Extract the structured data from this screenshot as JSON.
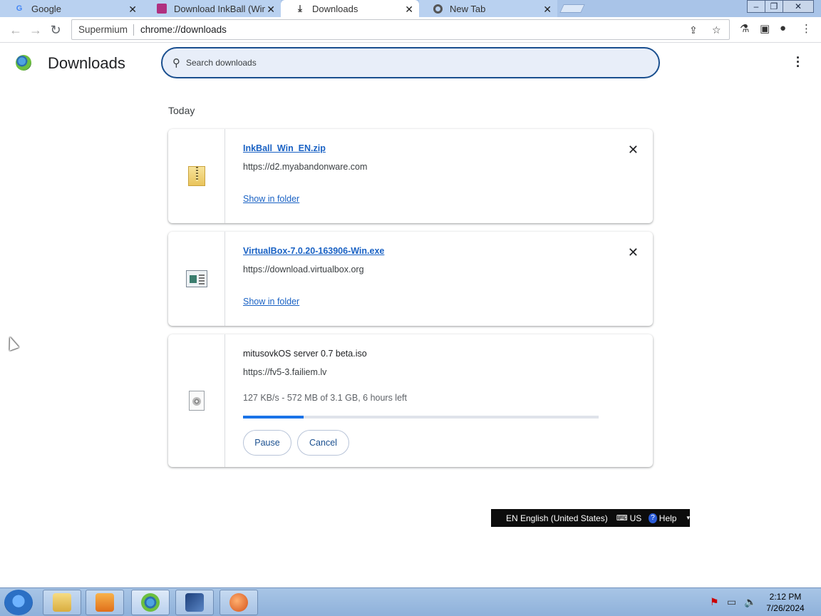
{
  "tabs": [
    {
      "label": "Google",
      "icon": "google-icon",
      "active": false
    },
    {
      "label": "Download InkBall (Win",
      "icon": "site-icon",
      "active": false
    },
    {
      "label": "Downloads",
      "icon": "download-icon",
      "active": true
    },
    {
      "label": "New Tab",
      "icon": "chromium-icon",
      "active": false
    }
  ],
  "toolbar": {
    "site_chip": "Supermium",
    "url": "chrome://downloads"
  },
  "page": {
    "title": "Downloads",
    "search_placeholder": "Search downloads",
    "section_label": "Today"
  },
  "downloads": [
    {
      "filename": "InkBall_Win_EN.zip",
      "source": "https://d2.myabandonware.com",
      "action": "Show in folder",
      "icon": "zip-file-icon"
    },
    {
      "filename": "VirtualBox-7.0.20-163906-Win.exe",
      "source": "https://download.virtualbox.org",
      "action": "Show in folder",
      "icon": "exe-file-icon"
    },
    {
      "filename": "mitusovkOS server 0.7 beta.iso",
      "source": "https://fv5-3.failiem.lv",
      "status": "127 KB/s - 572 MB of 3.1 GB, 6 hours left",
      "progress_fraction": 0.17,
      "pause_label": "Pause",
      "cancel_label": "Cancel",
      "icon": "iso-file-icon"
    }
  ],
  "language_bar": {
    "language": "EN English (United States)",
    "layout": "US",
    "help": "Help"
  },
  "clock": {
    "time": "2:12 PM",
    "date": "7/26/2024"
  },
  "colors": {
    "link": "#1a62c4",
    "progress": "#1a73e8",
    "search_border": "#1a4f8f"
  }
}
